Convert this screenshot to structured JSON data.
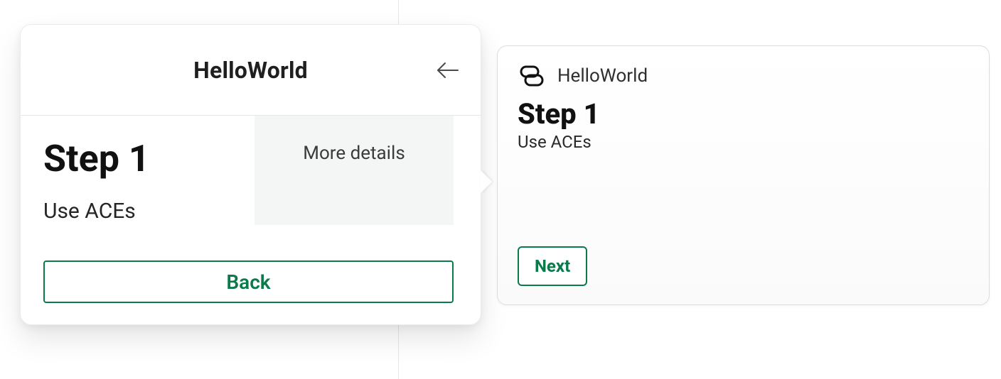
{
  "panel": {
    "title": "HelloWorld",
    "step_title": "Step 1",
    "step_subtitle": "Use ACEs",
    "more_details_label": "More details",
    "back_label": "Back"
  },
  "card": {
    "name": "HelloWorld",
    "step_title": "Step 1",
    "step_subtitle": "Use ACEs",
    "next_label": "Next"
  },
  "colors": {
    "accent": "#0b7a4b"
  }
}
